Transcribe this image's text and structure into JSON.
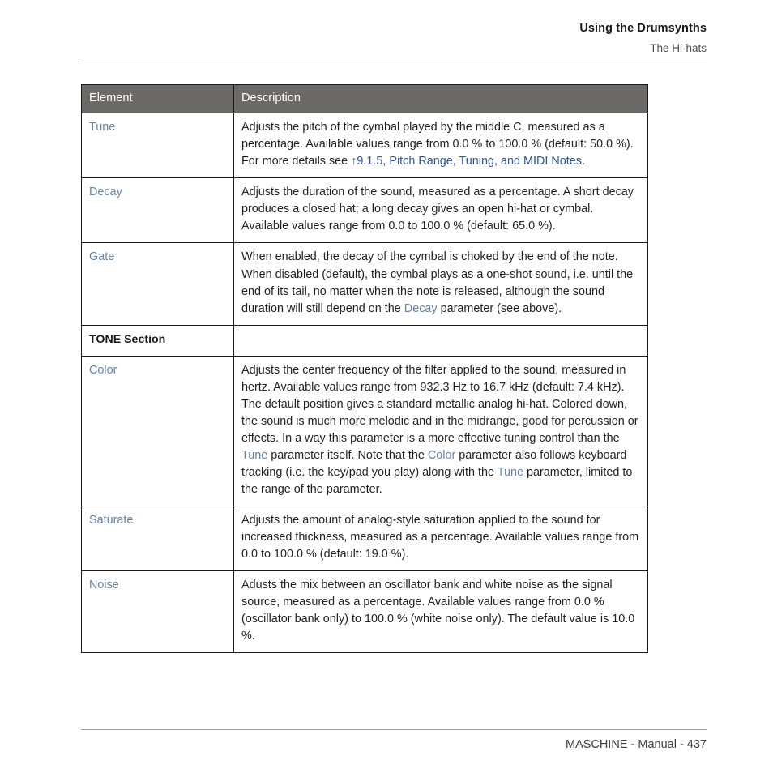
{
  "header": {
    "chapter_title": "Using the Drumsynths",
    "section_title": "The Hi-hats"
  },
  "table": {
    "columns": [
      "Element",
      "Description"
    ],
    "rows": [
      {
        "element": "Tune",
        "element_style": "link",
        "description_parts": [
          {
            "text": "Adjusts the pitch of the cymbal played by the middle C, measured as a percentage. Available values range from 0.0 % to 100.0 % (default: 50.0 %). For more details see ",
            "style": "plain"
          },
          {
            "text": "↑9.1.5, Pitch Range, Tuning, and MIDI Notes",
            "style": "xref"
          },
          {
            "text": ".",
            "style": "plain"
          }
        ]
      },
      {
        "element": "Decay",
        "element_style": "link",
        "description_parts": [
          {
            "text": "Adjusts the duration of the sound, measured as a percentage. A short decay produces a closed hat; a long decay gives an open hi-hat or cymbal. Available values range from 0.0 to 100.0 % (default: 65.0 %).",
            "style": "plain"
          }
        ]
      },
      {
        "element": "Gate",
        "element_style": "link",
        "description_parts": [
          {
            "text": "When enabled, the decay of the cymbal is choked by the end of the note. When disabled (default), the cymbal plays as a one-shot sound, i.e. until the end of its tail, no matter when the note is released, although the sound duration will still depend on the ",
            "style": "plain"
          },
          {
            "text": "Decay",
            "style": "link"
          },
          {
            "text": " parameter (see above).",
            "style": "plain"
          }
        ]
      },
      {
        "element": "TONE Section",
        "element_style": "section",
        "description_parts": []
      },
      {
        "element": "Color",
        "element_style": "link",
        "description_parts": [
          {
            "text": "Adjusts the center frequency of the filter applied to the sound, measured in hertz. Available values range from 932.3 Hz to 16.7 kHz (default: 7.4 kHz). The default position gives a standard metallic analog hi-hat. Colored down, the sound is much more melodic and in the midrange, good for percussion or effects. In a way this parameter is a more effective tuning control than the ",
            "style": "plain"
          },
          {
            "text": "Tune",
            "style": "link"
          },
          {
            "text": " parameter itself. Note that the ",
            "style": "plain"
          },
          {
            "text": "Color",
            "style": "link"
          },
          {
            "text": " parameter also follows keyboard tracking (i.e. the key/pad you play) along with the ",
            "style": "plain"
          },
          {
            "text": "Tune",
            "style": "link"
          },
          {
            "text": " parameter, limited to the range of the parameter.",
            "style": "plain"
          }
        ]
      },
      {
        "element": "Saturate",
        "element_style": "link",
        "description_parts": [
          {
            "text": "Adjusts the amount of analog-style saturation applied to the sound for increased thickness, measured as a percentage. Available values range from 0.0 to 100.0 % (default: 19.0 %).",
            "style": "plain"
          }
        ]
      },
      {
        "element": "Noise",
        "element_style": "link",
        "description_parts": [
          {
            "text": "Adusts the mix between an oscillator bank and white noise as the signal source, measured as a percentage. Available values range from 0.0 % (oscillator bank only) to 100.0 % (white noise only). The default value is 10.0 %.",
            "style": "plain"
          }
        ]
      }
    ]
  },
  "footer": {
    "text": "MASCHINE - Manual - 437"
  },
  "colors": {
    "header_row_bg": "#6b6a68",
    "param_link": "#6583ab",
    "cross_reference_link": "#2f5596",
    "body_text": "#231f20",
    "rule": "#9b9b9b"
  }
}
